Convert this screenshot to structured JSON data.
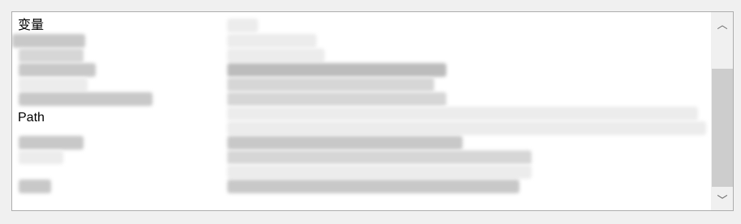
{
  "variables": {
    "rows": [
      {
        "name": "变量"
      },
      {
        "name": ""
      },
      {
        "name": ""
      },
      {
        "name": ""
      },
      {
        "name": ""
      },
      {
        "name": ""
      },
      {
        "name": ""
      },
      {
        "name": "Path"
      },
      {
        "name": ""
      },
      {
        "name": ""
      },
      {
        "name": ""
      },
      {
        "name": ""
      }
    ]
  },
  "scrollbar": {
    "up_icon": "chevron-up-icon",
    "down_icon": "chevron-down-icon",
    "up_glyph": "︿",
    "down_glyph": "﹀"
  }
}
